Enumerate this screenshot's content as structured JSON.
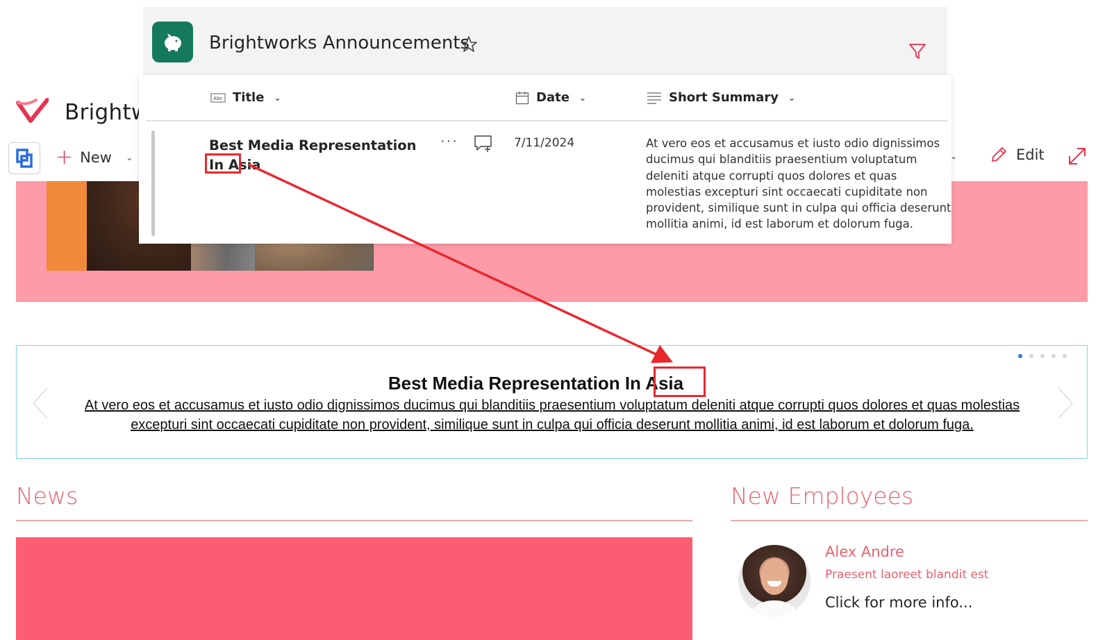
{
  "site": {
    "title": "Brightw",
    "new_label": "New",
    "edit_label": "Edit"
  },
  "carousel": {
    "title": "Best Media Representation In Asia",
    "body": "At vero eos et accusamus et iusto odio dignissimos ducimus qui blanditiis praesentium voluptatum deleniti atque corrupti quos dolores et quas molestias excepturi sint occaecati cupiditate non provident, similique sunt in culpa qui officia deserunt mollitia animi, id est laborum et dolorum fuga.",
    "dot_count": 5,
    "active_dot": 0
  },
  "sections": {
    "news": "News",
    "new_employees": "New Employees"
  },
  "employee": {
    "name": "Alex Andre",
    "role": "Praesent laoreet blandit est",
    "more": "Click for more info..."
  },
  "list": {
    "title": "Brightworks Announcements",
    "columns": {
      "title": "Title",
      "date": "Date",
      "summary": "Short Summary"
    },
    "row": {
      "title": "Best Media Representation In Asia",
      "more": "···",
      "date": "7/11/2024",
      "summary": "At vero eos et accusamus et iusto odio dignissimos ducimus qui blanditiis praesentium voluptatum deleniti atque corrupti quos dolores et quas molestias excepturi sint occaecati cupiditate non provident, similique sunt in culpa qui officia deserunt mollitia animi, id est laborum et dolorum fuga."
    }
  },
  "colors": {
    "accent": "#e8626f",
    "hero_band": "#fd9ba8",
    "news_block": "#fd5d73",
    "list_icon": "#157a5c",
    "annotation": "#e8282e"
  },
  "icons": [
    "brightworks-logo-icon",
    "app-switch-icon",
    "plus-icon",
    "chevron-down-icon",
    "pencil-icon",
    "expand-icon",
    "piggy-bank-icon",
    "star-icon",
    "filter-icon",
    "text-column-icon",
    "calendar-icon",
    "lines-icon",
    "more-icon",
    "comment-icon",
    "chevron-left-icon",
    "chevron-right-icon"
  ]
}
